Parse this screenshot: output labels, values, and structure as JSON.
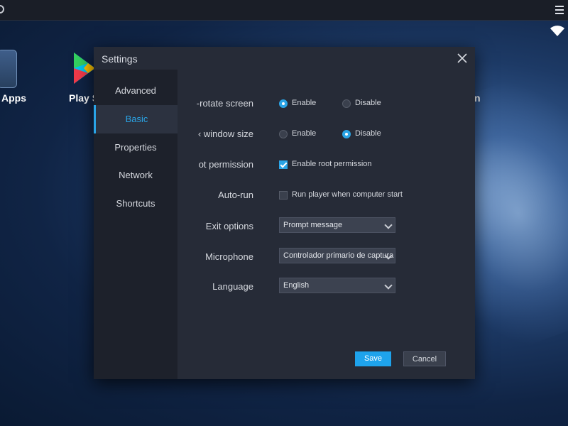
{
  "desktop": {
    "apps_label": "Apps",
    "play_label": "Play S",
    "right_label": "n"
  },
  "dialog": {
    "title": "Settings",
    "close_icon": "close-icon"
  },
  "sidebar": {
    "items": [
      {
        "label": "Advanced"
      },
      {
        "label": "Basic"
      },
      {
        "label": "Properties"
      },
      {
        "label": "Network"
      },
      {
        "label": "Shortcuts"
      }
    ],
    "active": "Basic"
  },
  "settings": {
    "rotate": {
      "label": "-rotate screen",
      "opt1": "Enable",
      "opt2": "Disable",
      "selected": "Enable"
    },
    "window_size": {
      "label": "‹ window size",
      "opt1": "Enable",
      "opt2": "Disable",
      "selected": "Disable"
    },
    "root": {
      "label": "ot permission",
      "checkbox_label": "Enable root permission",
      "checked": true
    },
    "autorun": {
      "label": "Auto-run",
      "checkbox_label": "Run player when computer start",
      "checked": false
    },
    "exit_options": {
      "label": "Exit options",
      "value": "Prompt message"
    },
    "microphone": {
      "label": "Microphone",
      "value": "Controlador primario de captura d"
    },
    "language": {
      "label": "Language",
      "value": "English"
    }
  },
  "buttons": {
    "save": "Save",
    "cancel": "Cancel"
  },
  "colors": {
    "accent": "#2aa4e6",
    "save_button": "#1ea3ec",
    "dialog_bg": "#262b37",
    "sidebar_bg": "#1d212b"
  }
}
